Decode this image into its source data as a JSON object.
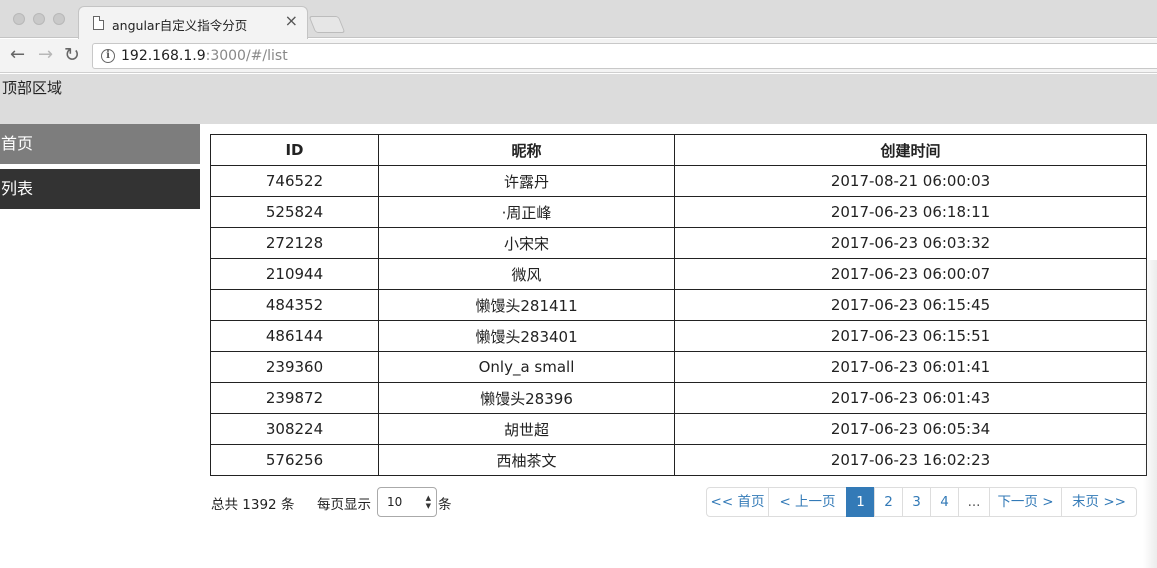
{
  "browser": {
    "tab_title": "angular自定义指令分页",
    "tab_close": "×",
    "url_host": "192.168.1.9",
    "url_rest": ":3000/#/list",
    "back_glyph": "←",
    "forward_glyph": "→",
    "reload_glyph": "↻",
    "info_glyph": "i"
  },
  "header": {
    "label": "顶部区域"
  },
  "sidebar": {
    "items": [
      {
        "label": "首页"
      },
      {
        "label": "列表"
      }
    ]
  },
  "table": {
    "headers": [
      "ID",
      "昵称",
      "创建时间"
    ],
    "rows": [
      [
        "746522",
        "许露丹",
        "2017-08-21 06:00:03"
      ],
      [
        "525824",
        "·周正峰",
        "2017-06-23 06:18:11"
      ],
      [
        "272128",
        "小宋宋",
        "2017-06-23 06:03:32"
      ],
      [
        "210944",
        "微风",
        "2017-06-23 06:00:07"
      ],
      [
        "484352",
        "懒馒头281411",
        "2017-06-23 06:15:45"
      ],
      [
        "486144",
        "懒馒头283401",
        "2017-06-23 06:15:51"
      ],
      [
        "239360",
        "Only_a small",
        "2017-06-23 06:01:41"
      ],
      [
        "239872",
        "懒馒头28396",
        "2017-06-23 06:01:43"
      ],
      [
        "308224",
        "胡世超",
        "2017-06-23 06:05:34"
      ],
      [
        "576256",
        "西柚茶文",
        "2017-06-23 16:02:23"
      ]
    ]
  },
  "footer": {
    "total_text": "总共 1392 条",
    "per_page_label": "每页显示",
    "per_page_value": "10",
    "per_page_suffix": "条"
  },
  "pagination": {
    "items": [
      {
        "label": "<< 首页",
        "name": "first-page"
      },
      {
        "label": "< 上一页",
        "name": "prev-page"
      },
      {
        "label": "1",
        "name": "page-1",
        "active": true
      },
      {
        "label": "2",
        "name": "page-2"
      },
      {
        "label": "3",
        "name": "page-3"
      },
      {
        "label": "4",
        "name": "page-4"
      },
      {
        "label": "...",
        "name": "page-ellipsis"
      },
      {
        "label": "下一页 >",
        "name": "next-page"
      },
      {
        "label": "末页 >>",
        "name": "last-page"
      }
    ],
    "active_color": "#337ab7"
  }
}
